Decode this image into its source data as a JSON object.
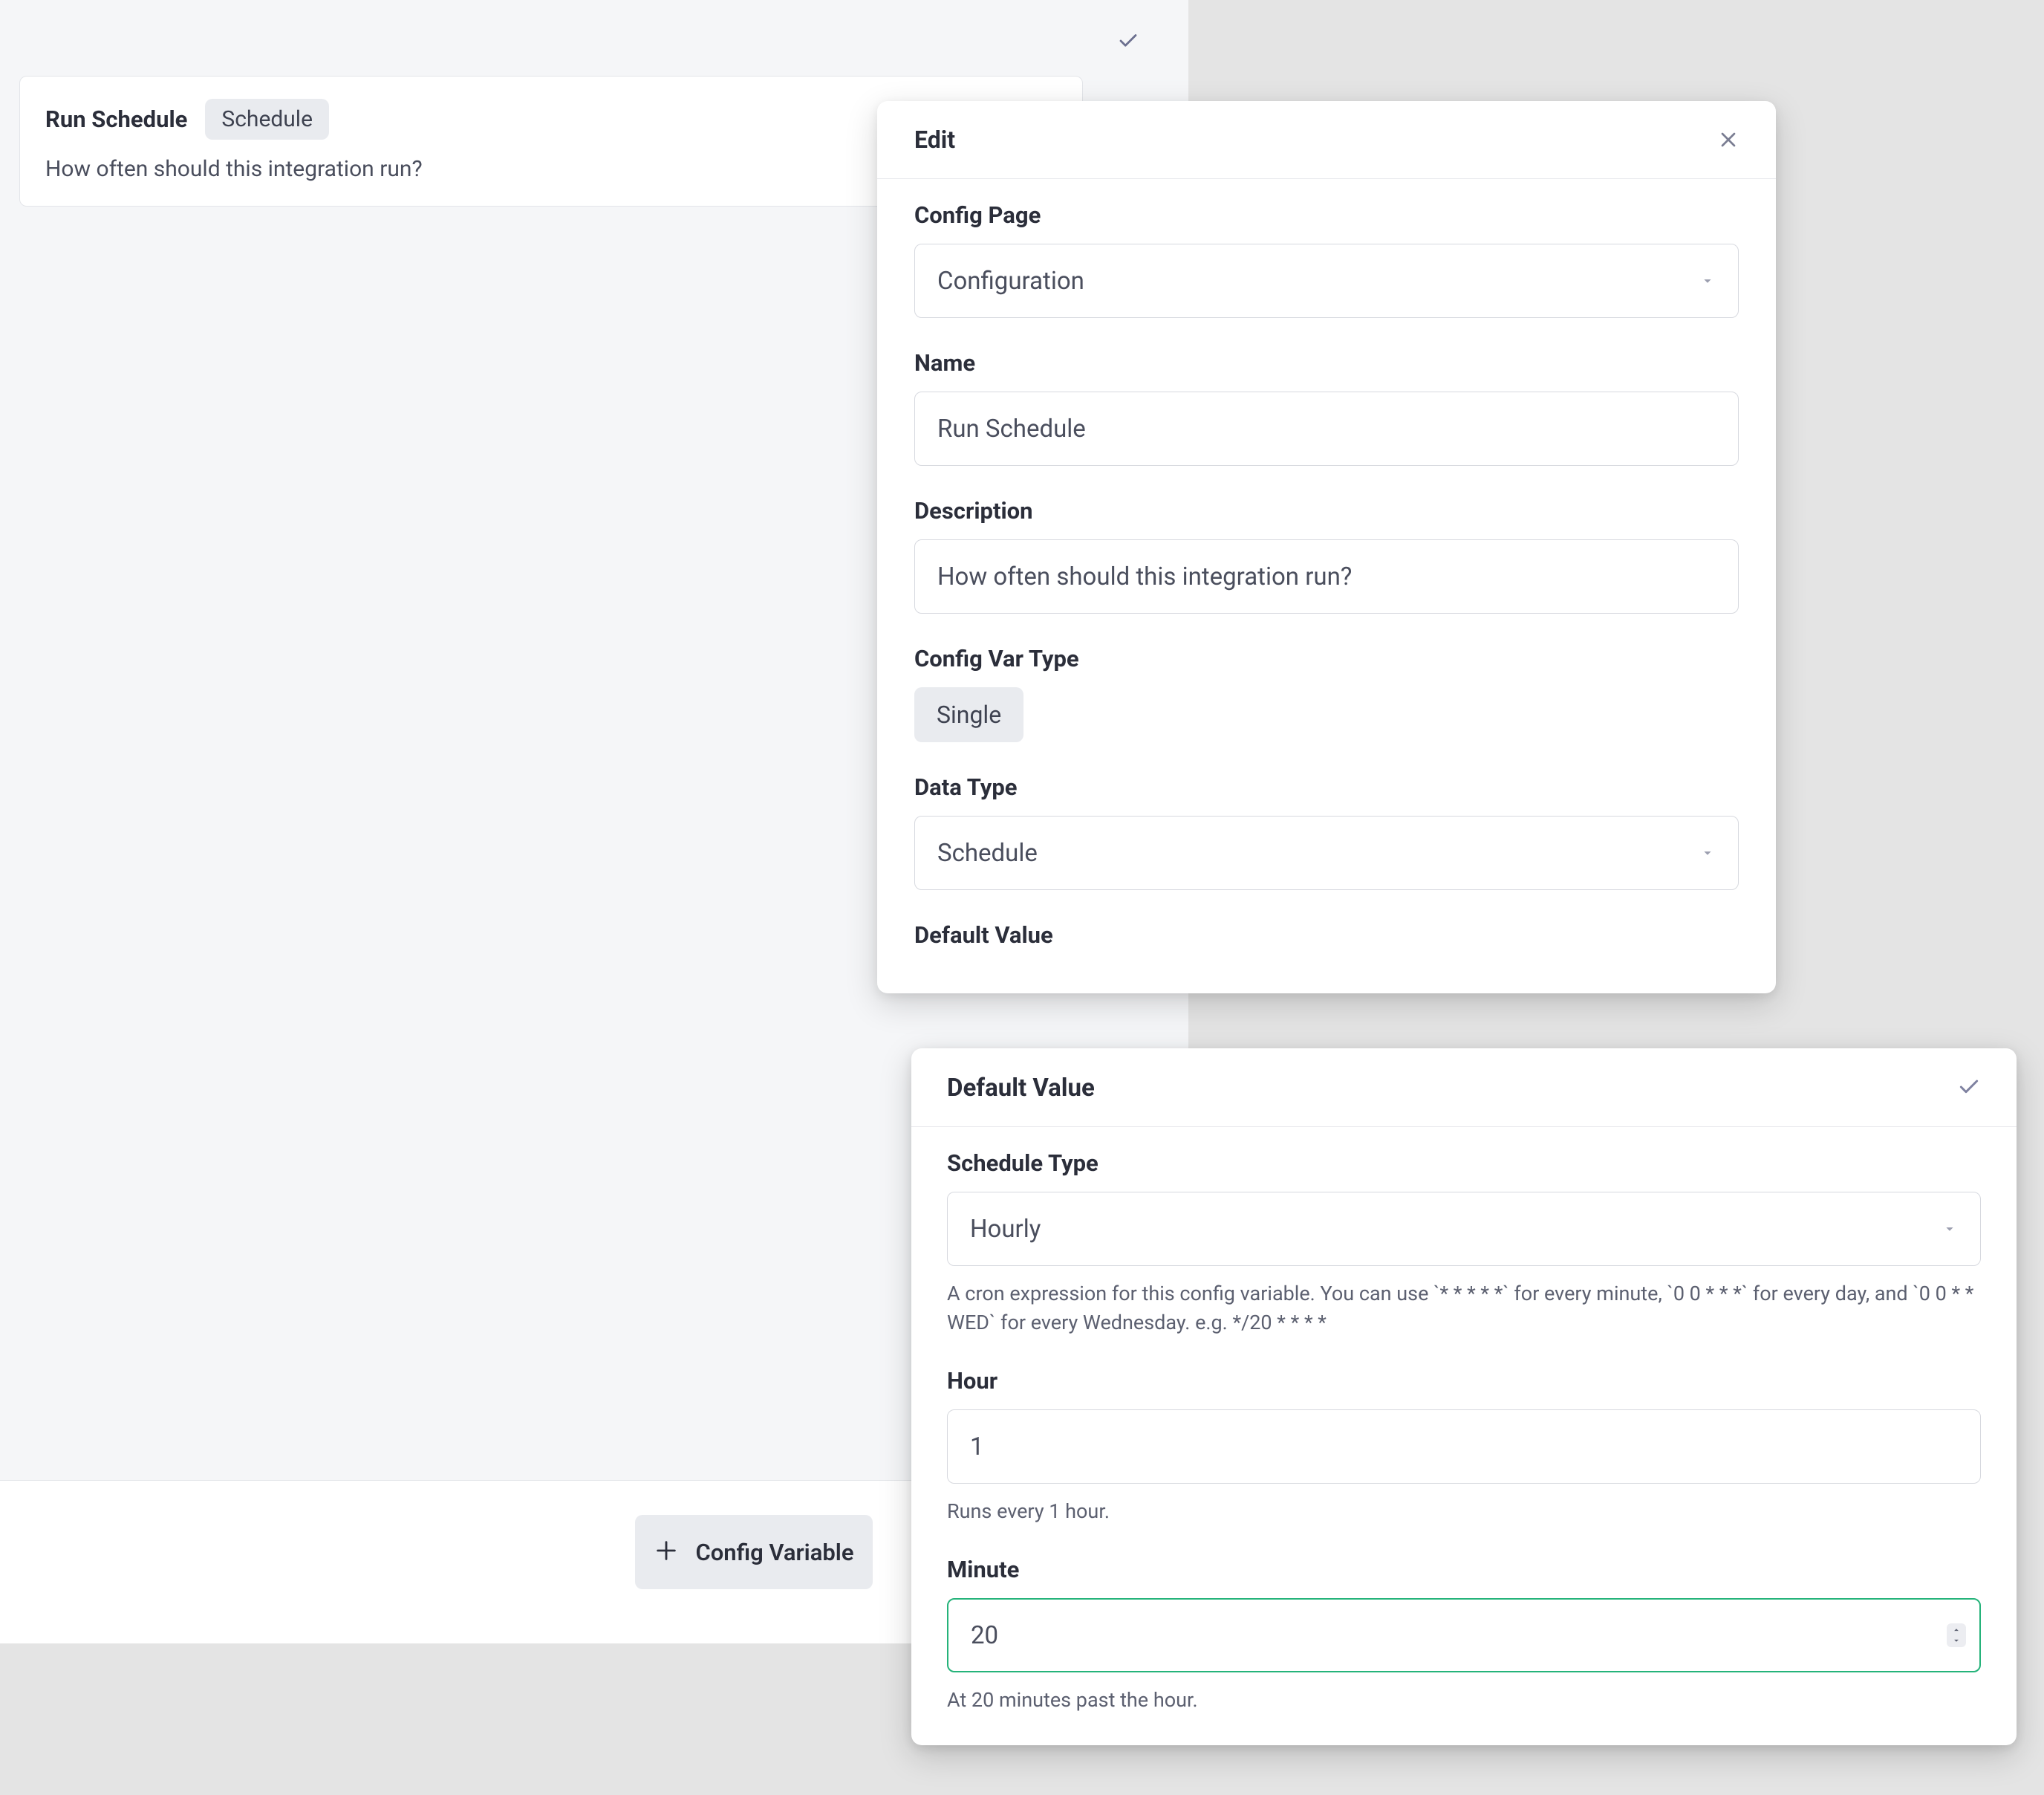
{
  "bg": {
    "card_title": "Run Schedule",
    "card_chip": "Schedule",
    "card_desc": "How often should this integration run?"
  },
  "footer": {
    "config_var_button": "Config Variable"
  },
  "edit_modal": {
    "title": "Edit",
    "fields": {
      "config_page": {
        "label": "Config Page",
        "value": "Configuration"
      },
      "name": {
        "label": "Name",
        "value": "Run Schedule"
      },
      "description": {
        "label": "Description",
        "value": "How often should this integration run?"
      },
      "config_var_type": {
        "label": "Config Var Type",
        "value": "Single"
      },
      "data_type": {
        "label": "Data Type",
        "value": "Schedule"
      },
      "default_value": {
        "label": "Default Value"
      }
    }
  },
  "default_value_popover": {
    "title": "Default Value",
    "schedule_type": {
      "label": "Schedule Type",
      "value": "Hourly",
      "help": "A cron expression for this config variable. You can use `* * * * *` for every minute, `0 0 * * *` for every day, and `0 0 * * WED` for every Wednesday. e.g. */20 * * * *"
    },
    "hour": {
      "label": "Hour",
      "value": "1",
      "help": "Runs every 1 hour."
    },
    "minute": {
      "label": "Minute",
      "value": "20",
      "help": "At 20 minutes past the hour."
    }
  }
}
